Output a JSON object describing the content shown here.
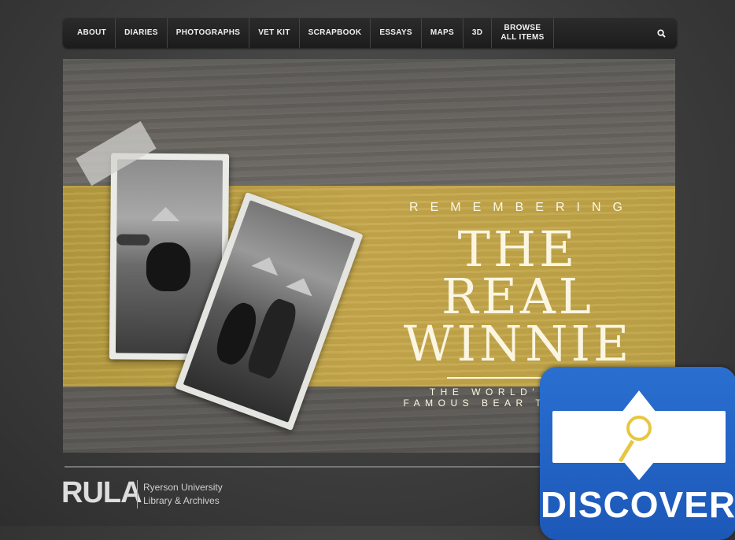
{
  "nav": {
    "items": [
      {
        "label": "ABOUT"
      },
      {
        "label": "DIARIES"
      },
      {
        "label": "PHOTOGRAPHS"
      },
      {
        "label": "VET KIT"
      },
      {
        "label": "SCRAPBOOK"
      },
      {
        "label": "ESSAYS"
      },
      {
        "label": "MAPS"
      },
      {
        "label": "3D"
      },
      {
        "label": "BROWSE\nALL ITEMS"
      }
    ],
    "search_icon": "search-icon"
  },
  "hero": {
    "kicker": "REMEMBERING",
    "headline_line1": "THE REAL",
    "headline_line2": "WINNIE",
    "subline_line1": "THE WORLD'S MOST",
    "subline_line2": "FAMOUS BEAR TURNS 100",
    "band_color": "#c2a544"
  },
  "footer": {
    "logo": "RULA",
    "org_line1": "Ryerson University",
    "org_line2": "Library & Archives"
  },
  "badge": {
    "label": "DISCOVER",
    "color": "#2466c8",
    "icon": "magnifier-icon"
  }
}
